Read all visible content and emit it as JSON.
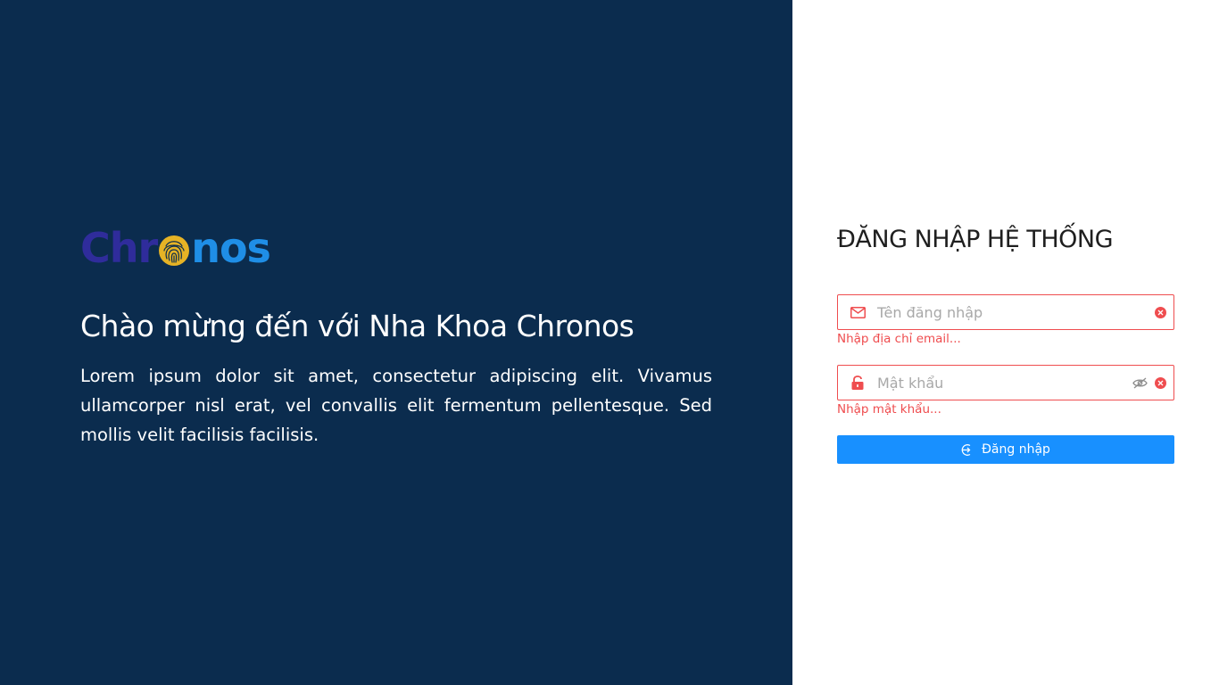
{
  "brand": {
    "logo_text_left": "Chr",
    "logo_text_right": "nos",
    "logo_icon": "fingerprint-icon",
    "colors": {
      "chr": "#2f2c9b",
      "nos": "#1f8ee6",
      "fingerprint": "#e6b325"
    }
  },
  "left": {
    "welcome": "Chào mừng đến với Nha Khoa Chronos",
    "description": "Lorem ipsum dolor sit amet, consectetur adipiscing elit. Vivamus ullamcorper nisl erat, vel convallis elit fermentum pellentesque. Sed mollis velit facilisis facilisis.",
    "background": "#0b2c4e"
  },
  "form": {
    "title": "ĐĂNG NHẬP HỆ THỐNG",
    "username": {
      "placeholder": "Tên đăng nhập",
      "value": "",
      "error": "Nhập địa chỉ email...",
      "prefix_icon": "mail-icon",
      "suffix_icon": "clear-icon"
    },
    "password": {
      "placeholder": "Mật khẩu",
      "value": "",
      "error": "Nhập mật khẩu...",
      "prefix_icon": "lock-icon",
      "suffix_icons": [
        "eye-invisible-icon",
        "clear-icon"
      ]
    },
    "submit_label": "Đăng nhập",
    "submit_icon": "login-icon",
    "colors": {
      "error": "#ef4d4f",
      "primary": "#1890ff"
    }
  }
}
